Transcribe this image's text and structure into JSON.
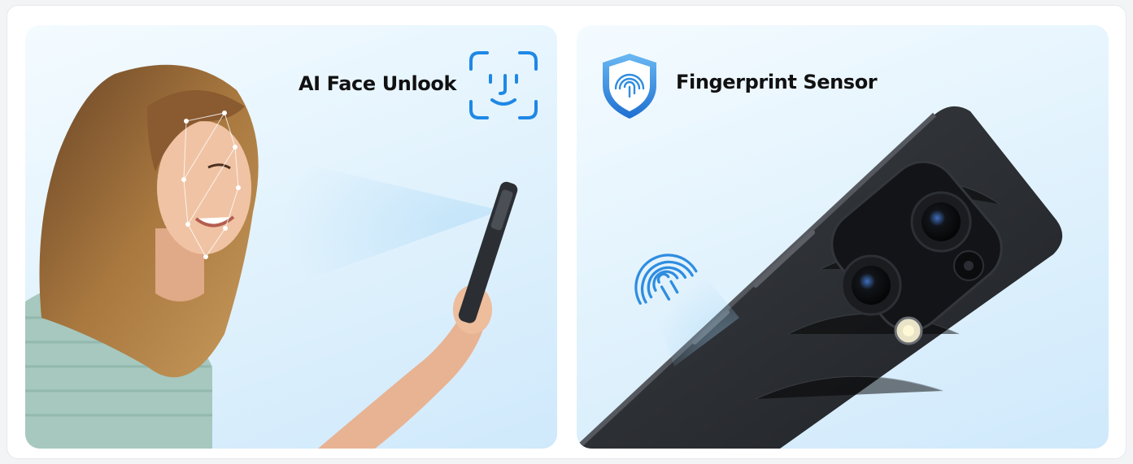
{
  "panels": {
    "face_unlock": {
      "title": "AI Face Unlook"
    },
    "fingerprint": {
      "title": "Fingerprint Sensor"
    }
  },
  "colors": {
    "accent": "#1e88e5",
    "panel_bg": "#e3f3fd",
    "phone_body": "#2c2f33"
  },
  "icons": {
    "face_unlock": "face-id-icon",
    "fingerprint": "shield-fingerprint-icon"
  }
}
